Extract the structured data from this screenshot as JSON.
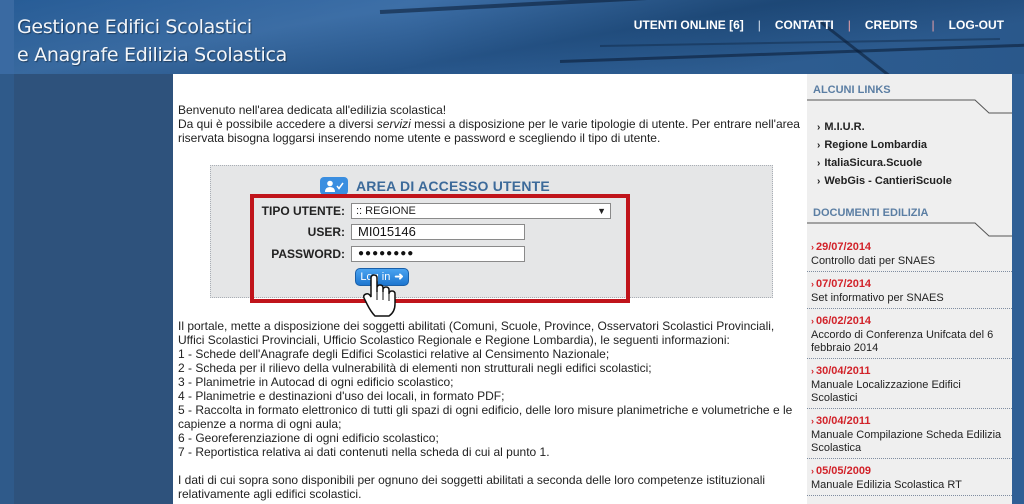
{
  "header": {
    "title_line1": "Gestione Edifici Scolastici",
    "title_line2": "e Anagrafe Edilizia Scolastica",
    "nav": [
      {
        "label": "UTENTI ONLINE [6]"
      },
      {
        "label": "CONTATTI"
      },
      {
        "label": "CREDITS"
      },
      {
        "label": "LOG-OUT"
      }
    ],
    "separator": "|"
  },
  "main": {
    "welcome": "Benvenuto nell'area dedicata all'edilizia scolastica!",
    "intro_before": "Da qui è possibile accedere a diversi ",
    "intro_em": "servizi",
    "intro_after": " messi a disposizione per le varie tipologie di utente. Per entrare nell'area riservata bisogna loggarsi inserendo nome utente e password e scegliendo il tipo di utente.",
    "login": {
      "title": "AREA DI ACCESSO UTENTE",
      "tipo_label": "TIPO UTENTE:",
      "tipo_value": ":: REGIONE",
      "user_label": "USER:",
      "user_value": "MI015146",
      "password_label": "PASSWORD:",
      "password_value": "●●●●●●●●",
      "button_label": "Log in",
      "button_icon": "arrow-right-icon"
    },
    "portal_intro": "Il portale, mette a disposizione dei soggetti abilitati (Comuni, Scuole, Province, Osservatori Scolastici Provinciali, Uffici Scolastici Provinciali, Ufficio Scolastico Regionale e Regione Lombardia), le seguenti informazioni:",
    "list": [
      "1 - Schede dell'Anagrafe degli Edifici Scolastici relative al Censimento Nazionale;",
      "2 - Scheda per il rilievo della vulnerabilità di elementi non strutturali negli edifici scolastici;",
      "3 - Planimetrie in Autocad di ogni edificio scolastico;",
      "4 - Planimetrie e destinazioni d'uso dei locali, in formato PDF;",
      "5 - Raccolta in formato elettronico di tutti gli spazi di ogni edificio, delle loro misure planimetriche e volumetriche e le capienze a norma di ogni aula;",
      "6 - Georeferenziazione di ogni edificio scolastico;",
      "7 - Reportistica relativa ai dati contenuti nella scheda di cui al punto 1."
    ],
    "closing": "I dati di cui sopra sono disponibili per ognuno dei soggetti abilitati a seconda delle loro competenze istituzionali relativamente agli edifici scolastici."
  },
  "sidebar": {
    "links_heading": "ALCUNI LINKS",
    "links": [
      {
        "label": "M.I.U.R."
      },
      {
        "label": "Regione Lombardia"
      },
      {
        "label": "ItaliaSicura.Scuole"
      },
      {
        "label": "WebGis - CantieriScuole"
      }
    ],
    "docs_heading": "DOCUMENTI EDILIZIA",
    "docs": [
      {
        "date": "29/07/2014",
        "title": "Controllo dati per SNAES"
      },
      {
        "date": "07/07/2014",
        "title": "Set informativo per SNAES"
      },
      {
        "date": "06/02/2014",
        "title": "Accordo di Conferenza Unifcata del 6 febbraio 2014"
      },
      {
        "date": "30/04/2011",
        "title": "Manuale Localizzazione Edifici Scolastici"
      },
      {
        "date": "30/04/2011",
        "title": "Manuale Compilazione Scheda Edilizia Scolastica"
      },
      {
        "date": "05/05/2009",
        "title": "Manuale Edilizia Scolastica RT"
      }
    ],
    "chevron": "›"
  }
}
